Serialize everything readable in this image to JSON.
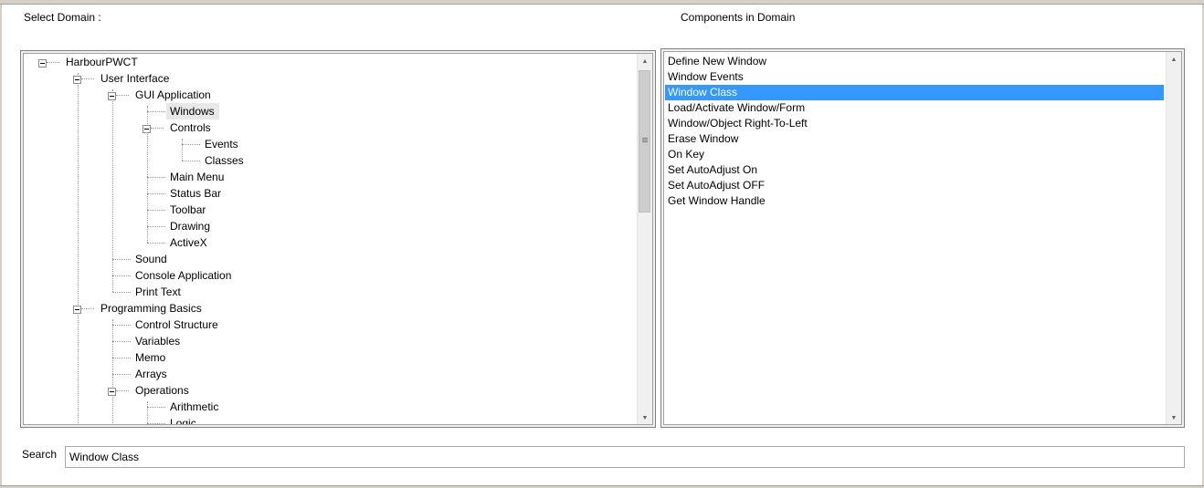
{
  "labels": {
    "select_domain": "Select Domain :",
    "components_in_domain": "Components in Domain",
    "search": "Search"
  },
  "tree": {
    "root": "HarbourPWCT",
    "user_interface": "User Interface",
    "gui_application": "GUI Application",
    "windows": "Windows",
    "controls": "Controls",
    "events": "Events",
    "classes": "Classes",
    "main_menu": "Main Menu",
    "status_bar": "Status Bar",
    "toolbar": "Toolbar",
    "drawing": "Drawing",
    "activex": "ActiveX",
    "sound": "Sound",
    "console_application": "Console Application",
    "print_text": "Print Text",
    "programming_basics": "Programming Basics",
    "control_structure": "Control Structure",
    "variables": "Variables",
    "memo": "Memo",
    "arrays": "Arrays",
    "operations": "Operations",
    "arithmetic": "Arithmetic",
    "logic": "Logic",
    "selected": "Windows"
  },
  "components": {
    "items": [
      "Define New Window",
      "Window Events",
      "Window Class",
      "Load/Activate Window/Form",
      "Window/Object Right-To-Left",
      "Erase Window",
      "On Key",
      "Set AutoAdjust On",
      "Set AutoAdjust OFF",
      "Get Window Handle"
    ],
    "selected": "Window Class"
  },
  "search": {
    "value": "Window Class"
  },
  "icons": {
    "scroll_up": "▲",
    "scroll_down": "▼"
  },
  "colors": {
    "selection": "#3399ff",
    "tree_selection": "#e8e8e8"
  }
}
